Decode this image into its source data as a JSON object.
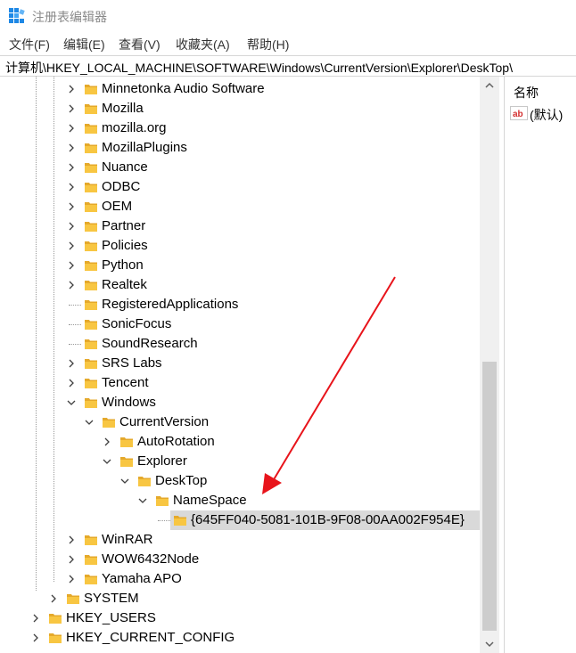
{
  "window": {
    "title": "注册表编辑器"
  },
  "menu": [
    {
      "label": "文件(F)"
    },
    {
      "label": "编辑(E)"
    },
    {
      "label": "查看(V)"
    },
    {
      "label": "收藏夹(A)"
    },
    {
      "label": "帮助(H)"
    }
  ],
  "address": {
    "path": "计算机\\HKEY_LOCAL_MACHINE\\SOFTWARE\\Windows\\CurrentVersion\\Explorer\\DeskTop\\"
  },
  "tree": [
    {
      "label": "Minnetonka Audio Software",
      "depth": 2,
      "expander": "collapsed"
    },
    {
      "label": "Mozilla",
      "depth": 2,
      "expander": "collapsed"
    },
    {
      "label": "mozilla.org",
      "depth": 2,
      "expander": "collapsed"
    },
    {
      "label": "MozillaPlugins",
      "depth": 2,
      "expander": "collapsed"
    },
    {
      "label": "Nuance",
      "depth": 2,
      "expander": "collapsed"
    },
    {
      "label": "ODBC",
      "depth": 2,
      "expander": "collapsed"
    },
    {
      "label": "OEM",
      "depth": 2,
      "expander": "collapsed"
    },
    {
      "label": "Partner",
      "depth": 2,
      "expander": "collapsed"
    },
    {
      "label": "Policies",
      "depth": 2,
      "expander": "collapsed"
    },
    {
      "label": "Python",
      "depth": 2,
      "expander": "collapsed"
    },
    {
      "label": "Realtek",
      "depth": 2,
      "expander": "collapsed"
    },
    {
      "label": "RegisteredApplications",
      "depth": 2,
      "expander": "none"
    },
    {
      "label": "SonicFocus",
      "depth": 2,
      "expander": "none"
    },
    {
      "label": "SoundResearch",
      "depth": 2,
      "expander": "none"
    },
    {
      "label": "SRS Labs",
      "depth": 2,
      "expander": "collapsed"
    },
    {
      "label": "Tencent",
      "depth": 2,
      "expander": "collapsed"
    },
    {
      "label": "Windows",
      "depth": 2,
      "expander": "expanded"
    },
    {
      "label": "CurrentVersion",
      "depth": 3,
      "expander": "expanded"
    },
    {
      "label": "AutoRotation",
      "depth": 4,
      "expander": "collapsed"
    },
    {
      "label": "Explorer",
      "depth": 4,
      "expander": "expanded"
    },
    {
      "label": "DeskTop",
      "depth": 5,
      "expander": "expanded"
    },
    {
      "label": "NameSpace",
      "depth": 6,
      "expander": "expanded"
    },
    {
      "label": "{645FF040-5081-101B-9F08-00AA002F954E}",
      "depth": 7,
      "expander": "none",
      "selected": true
    },
    {
      "label": "WinRAR",
      "depth": 2,
      "expander": "collapsed"
    },
    {
      "label": "WOW6432Node",
      "depth": 2,
      "expander": "collapsed"
    },
    {
      "label": "Yamaha APO",
      "depth": 2,
      "expander": "collapsed"
    },
    {
      "label": "SYSTEM",
      "depth": 1,
      "expander": "collapsed"
    },
    {
      "label": "HKEY_USERS",
      "depth": 0,
      "expander": "collapsed"
    },
    {
      "label": "HKEY_CURRENT_CONFIG",
      "depth": 0,
      "expander": "collapsed"
    }
  ],
  "values": {
    "column_name": "名称",
    "rows": [
      {
        "name": "(默认)",
        "icon": "string-value-icon"
      }
    ]
  },
  "icons": {
    "app": "registry-editor-icon",
    "folder": "folder-icon"
  },
  "colors": {
    "folder": "#f8c642",
    "selection": "#d9d9d9",
    "arrow": "#e8141b",
    "scroll_thumb": "#cdcdcd"
  }
}
